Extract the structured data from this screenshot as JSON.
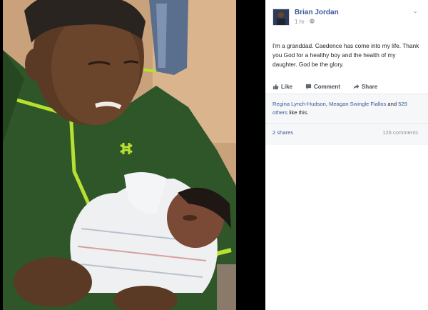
{
  "post": {
    "author": "Brian Jordan",
    "time": "1 hr",
    "text": "I'm a granddad. Caedence has come into my life. Thank you God for a healthy boy and the health of my daughter. God be the glory."
  },
  "actions": {
    "like": "Like",
    "comment": "Comment",
    "share": "Share"
  },
  "likes": {
    "name1": "Regina Lynch-Hudson",
    "sep": ", ",
    "name2": "Meagan Swingle Fiallos",
    "and": " and ",
    "others": "529 others",
    "suffix": " like this."
  },
  "stats": {
    "shares": "2 shares",
    "comments": "126 comments"
  },
  "colors": {
    "link": "#3b5998",
    "muted": "#90949c",
    "jacket": "#2f5a2c",
    "accent": "#b8e030"
  }
}
